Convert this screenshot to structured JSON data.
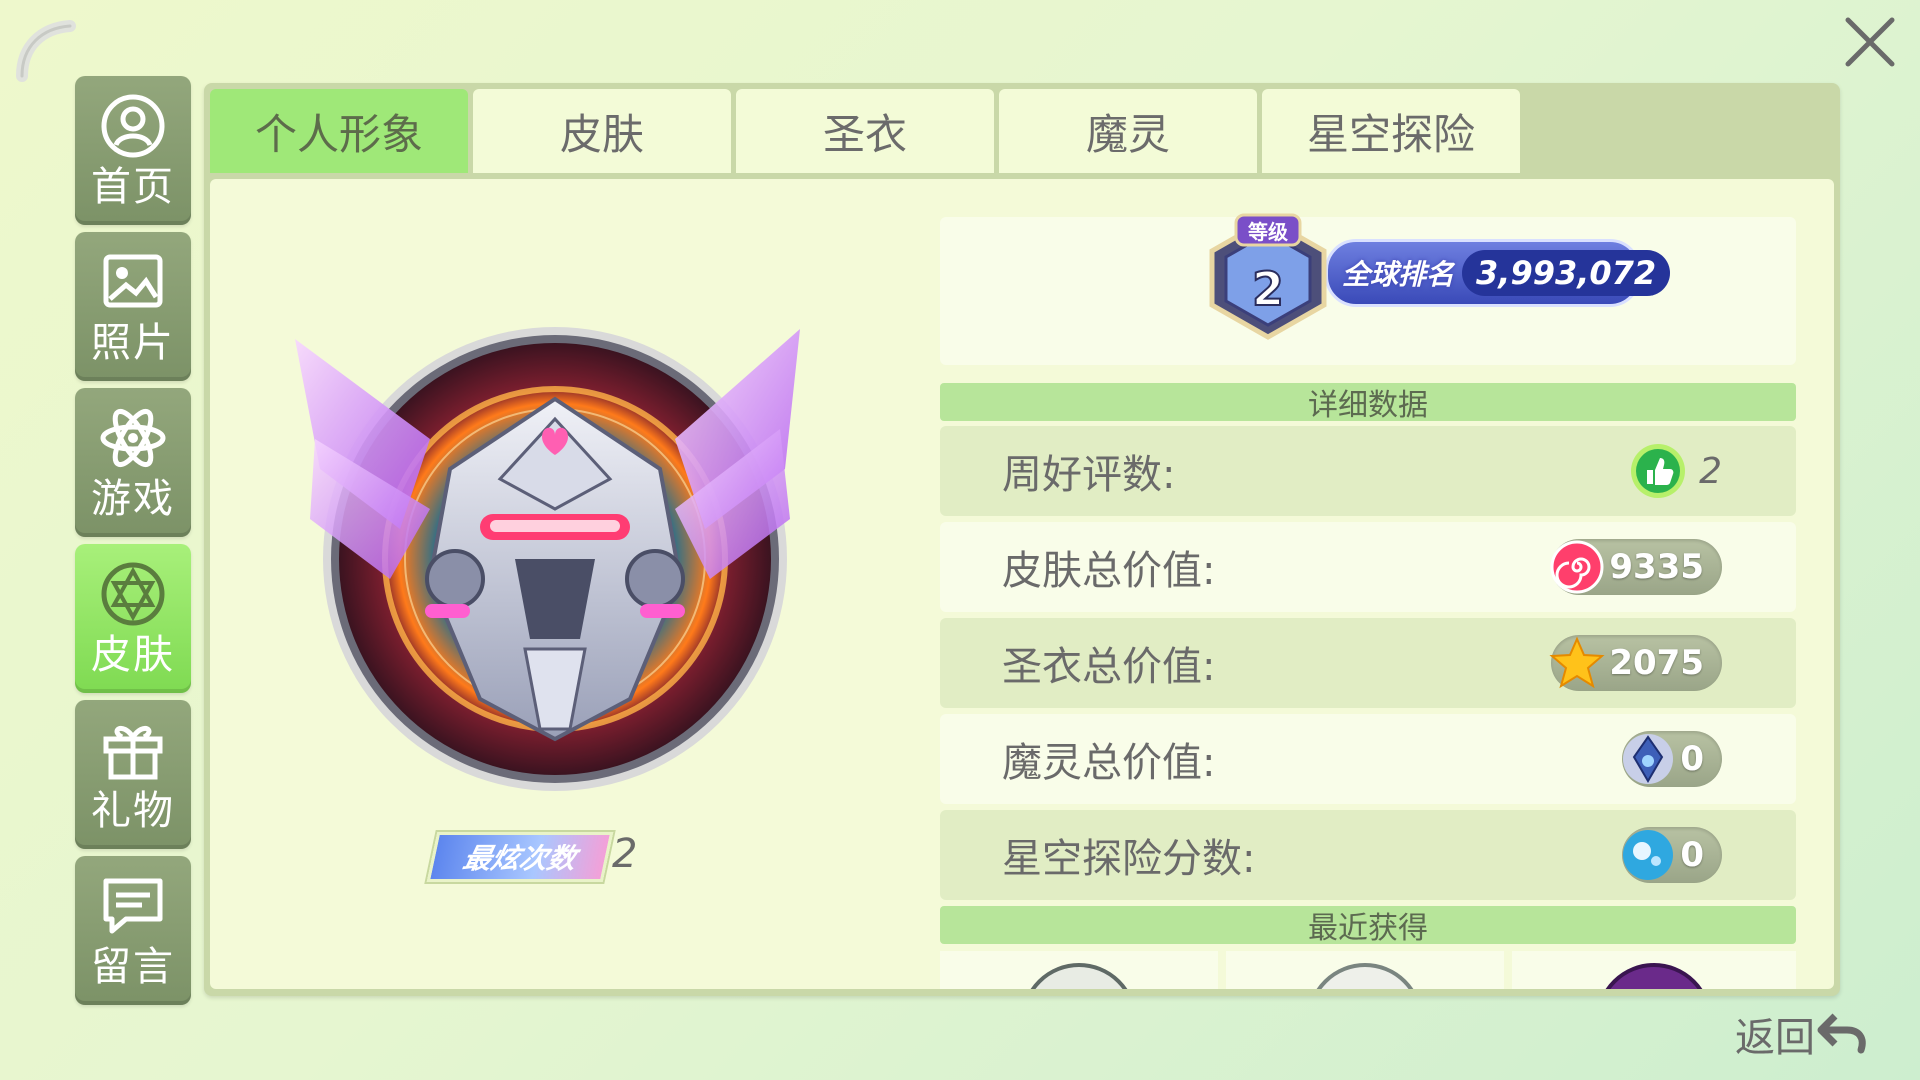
{
  "sidebar": {
    "items": [
      {
        "label": "首页",
        "icon": "user-circle-icon"
      },
      {
        "label": "照片",
        "icon": "photo-icon"
      },
      {
        "label": "游戏",
        "icon": "atom-icon"
      },
      {
        "label": "皮肤",
        "icon": "skin-ring-icon",
        "active": true
      },
      {
        "label": "礼物",
        "icon": "gift-icon"
      },
      {
        "label": "留言",
        "icon": "message-icon"
      }
    ]
  },
  "tabs": [
    {
      "label": "个人形象",
      "active": true
    },
    {
      "label": "皮肤"
    },
    {
      "label": "圣衣"
    },
    {
      "label": "魔灵"
    },
    {
      "label": "星空探险"
    }
  ],
  "profile": {
    "level_label": "等级",
    "level": "2",
    "rank_label": "全球排名",
    "rank_value": "3,993,072",
    "cheer_label": "最炫次数",
    "cheer_value": "2"
  },
  "details": {
    "section_title": "详细数据",
    "stats": [
      {
        "label": "周好评数:",
        "value": "2",
        "icon": "thumbs-up-icon"
      },
      {
        "label": "皮肤总价值:",
        "value": "9335",
        "icon": "candy-swirl-icon"
      },
      {
        "label": "圣衣总价值:",
        "value": "2075",
        "icon": "star-icon"
      },
      {
        "label": "魔灵总价值:",
        "value": "0",
        "icon": "spirit-crystal-icon"
      },
      {
        "label": "星空探险分数:",
        "value": "0",
        "icon": "planet-icon"
      }
    ]
  },
  "recent": {
    "section_title": "最近获得"
  },
  "footer": {
    "back_label": "返回"
  },
  "colors": {
    "active_green": "#9fe878",
    "sidebar_bg": "#889c72",
    "panel_bg": "#f4fad8"
  }
}
